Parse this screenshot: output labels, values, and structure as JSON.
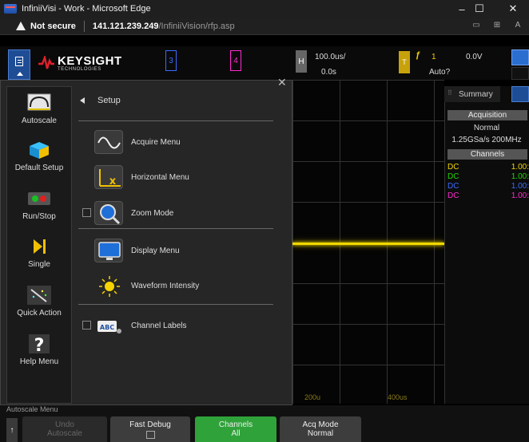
{
  "window": {
    "title": "InfiniiVisi - Work - Microsoft Edge",
    "minimize": "–",
    "maximize": "☐",
    "close": "✕"
  },
  "address": {
    "security": "Not secure",
    "host": "141.121.239.249",
    "path": "/InfiniiVision/rfp.asp"
  },
  "scope": {
    "brand": "KEYSIGHT",
    "brand_sub": "TECHNOLOGIES",
    "channels": [
      {
        "label": "3",
        "color": "#3a6cff"
      },
      {
        "label": "4",
        "color": "#ff2bd0"
      }
    ],
    "horizontal": {
      "badge": "H",
      "scale": "100.0us/",
      "delay": "0.0s"
    },
    "trigger": {
      "badge": "T",
      "slope_icon": "rising-edge-icon",
      "channel": "1",
      "level": "0.0V",
      "mode": "Auto?"
    }
  },
  "grid": {
    "x_labels": [
      "200u",
      "400us"
    ]
  },
  "summary": {
    "tab": "Summary",
    "acq_header": "Acquisition",
    "acq_mode": "Normal",
    "acq_rate": "1.25GSa/s  200MHz",
    "ch_header": "Channels",
    "rows": [
      {
        "coupling": "DC",
        "scale": "1.00:",
        "color": "#f0d800"
      },
      {
        "coupling": "DC",
        "scale": "1.00:",
        "color": "#22d400"
      },
      {
        "coupling": "DC",
        "scale": "1.00:",
        "color": "#3a6cff"
      },
      {
        "coupling": "DC",
        "scale": "1.00:",
        "color": "#ff2bd0"
      }
    ]
  },
  "overlay": {
    "close": "✕",
    "left_buttons": [
      {
        "label": "Autoscale"
      },
      {
        "label": "Default Setup"
      },
      {
        "label": "Run/Stop"
      },
      {
        "label": "Single"
      },
      {
        "label": "Quick Action"
      },
      {
        "label": "Help Menu"
      }
    ],
    "setup_title": "Setup",
    "items": [
      {
        "label": "Acquire Menu"
      },
      {
        "label": "Horizontal Menu"
      },
      {
        "label": "Zoom Mode"
      },
      {
        "label": "Display Menu"
      },
      {
        "label": "Waveform Intensity"
      },
      {
        "label": "Channel Labels"
      }
    ]
  },
  "bottom": {
    "menu_label": "Autoscale Menu",
    "buttons": [
      {
        "title": "Undo",
        "sub": "Autoscale"
      },
      {
        "title": "Fast Debug",
        "sub": ""
      },
      {
        "title": "Channels",
        "sub": "All"
      },
      {
        "title": "Acq Mode",
        "sub": "Normal"
      }
    ]
  }
}
